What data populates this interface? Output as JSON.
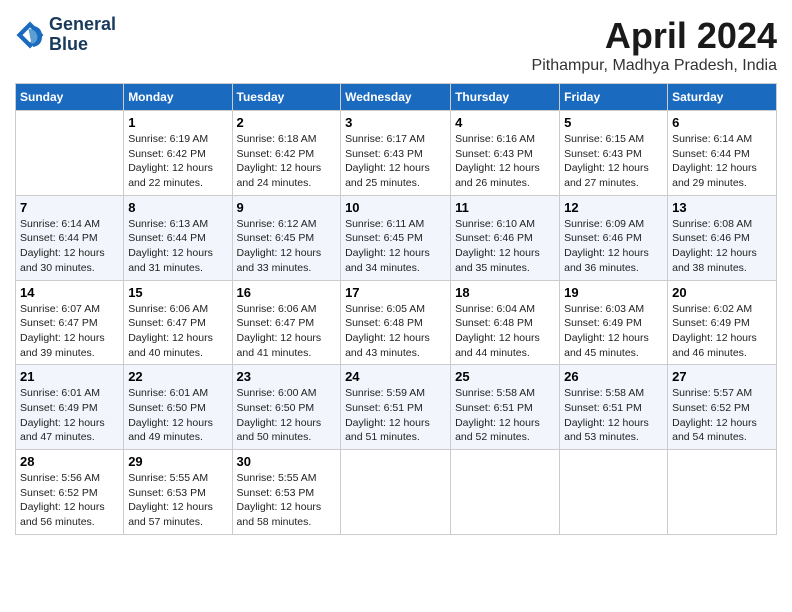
{
  "header": {
    "logo_line1": "General",
    "logo_line2": "Blue",
    "month": "April 2024",
    "location": "Pithampur, Madhya Pradesh, India"
  },
  "weekdays": [
    "Sunday",
    "Monday",
    "Tuesday",
    "Wednesday",
    "Thursday",
    "Friday",
    "Saturday"
  ],
  "weeks": [
    [
      {
        "day": "",
        "text": ""
      },
      {
        "day": "1",
        "text": "Sunrise: 6:19 AM\nSunset: 6:42 PM\nDaylight: 12 hours\nand 22 minutes."
      },
      {
        "day": "2",
        "text": "Sunrise: 6:18 AM\nSunset: 6:42 PM\nDaylight: 12 hours\nand 24 minutes."
      },
      {
        "day": "3",
        "text": "Sunrise: 6:17 AM\nSunset: 6:43 PM\nDaylight: 12 hours\nand 25 minutes."
      },
      {
        "day": "4",
        "text": "Sunrise: 6:16 AM\nSunset: 6:43 PM\nDaylight: 12 hours\nand 26 minutes."
      },
      {
        "day": "5",
        "text": "Sunrise: 6:15 AM\nSunset: 6:43 PM\nDaylight: 12 hours\nand 27 minutes."
      },
      {
        "day": "6",
        "text": "Sunrise: 6:14 AM\nSunset: 6:44 PM\nDaylight: 12 hours\nand 29 minutes."
      }
    ],
    [
      {
        "day": "7",
        "text": "Sunrise: 6:14 AM\nSunset: 6:44 PM\nDaylight: 12 hours\nand 30 minutes."
      },
      {
        "day": "8",
        "text": "Sunrise: 6:13 AM\nSunset: 6:44 PM\nDaylight: 12 hours\nand 31 minutes."
      },
      {
        "day": "9",
        "text": "Sunrise: 6:12 AM\nSunset: 6:45 PM\nDaylight: 12 hours\nand 33 minutes."
      },
      {
        "day": "10",
        "text": "Sunrise: 6:11 AM\nSunset: 6:45 PM\nDaylight: 12 hours\nand 34 minutes."
      },
      {
        "day": "11",
        "text": "Sunrise: 6:10 AM\nSunset: 6:46 PM\nDaylight: 12 hours\nand 35 minutes."
      },
      {
        "day": "12",
        "text": "Sunrise: 6:09 AM\nSunset: 6:46 PM\nDaylight: 12 hours\nand 36 minutes."
      },
      {
        "day": "13",
        "text": "Sunrise: 6:08 AM\nSunset: 6:46 PM\nDaylight: 12 hours\nand 38 minutes."
      }
    ],
    [
      {
        "day": "14",
        "text": "Sunrise: 6:07 AM\nSunset: 6:47 PM\nDaylight: 12 hours\nand 39 minutes."
      },
      {
        "day": "15",
        "text": "Sunrise: 6:06 AM\nSunset: 6:47 PM\nDaylight: 12 hours\nand 40 minutes."
      },
      {
        "day": "16",
        "text": "Sunrise: 6:06 AM\nSunset: 6:47 PM\nDaylight: 12 hours\nand 41 minutes."
      },
      {
        "day": "17",
        "text": "Sunrise: 6:05 AM\nSunset: 6:48 PM\nDaylight: 12 hours\nand 43 minutes."
      },
      {
        "day": "18",
        "text": "Sunrise: 6:04 AM\nSunset: 6:48 PM\nDaylight: 12 hours\nand 44 minutes."
      },
      {
        "day": "19",
        "text": "Sunrise: 6:03 AM\nSunset: 6:49 PM\nDaylight: 12 hours\nand 45 minutes."
      },
      {
        "day": "20",
        "text": "Sunrise: 6:02 AM\nSunset: 6:49 PM\nDaylight: 12 hours\nand 46 minutes."
      }
    ],
    [
      {
        "day": "21",
        "text": "Sunrise: 6:01 AM\nSunset: 6:49 PM\nDaylight: 12 hours\nand 47 minutes."
      },
      {
        "day": "22",
        "text": "Sunrise: 6:01 AM\nSunset: 6:50 PM\nDaylight: 12 hours\nand 49 minutes."
      },
      {
        "day": "23",
        "text": "Sunrise: 6:00 AM\nSunset: 6:50 PM\nDaylight: 12 hours\nand 50 minutes."
      },
      {
        "day": "24",
        "text": "Sunrise: 5:59 AM\nSunset: 6:51 PM\nDaylight: 12 hours\nand 51 minutes."
      },
      {
        "day": "25",
        "text": "Sunrise: 5:58 AM\nSunset: 6:51 PM\nDaylight: 12 hours\nand 52 minutes."
      },
      {
        "day": "26",
        "text": "Sunrise: 5:58 AM\nSunset: 6:51 PM\nDaylight: 12 hours\nand 53 minutes."
      },
      {
        "day": "27",
        "text": "Sunrise: 5:57 AM\nSunset: 6:52 PM\nDaylight: 12 hours\nand 54 minutes."
      }
    ],
    [
      {
        "day": "28",
        "text": "Sunrise: 5:56 AM\nSunset: 6:52 PM\nDaylight: 12 hours\nand 56 minutes."
      },
      {
        "day": "29",
        "text": "Sunrise: 5:55 AM\nSunset: 6:53 PM\nDaylight: 12 hours\nand 57 minutes."
      },
      {
        "day": "30",
        "text": "Sunrise: 5:55 AM\nSunset: 6:53 PM\nDaylight: 12 hours\nand 58 minutes."
      },
      {
        "day": "",
        "text": ""
      },
      {
        "day": "",
        "text": ""
      },
      {
        "day": "",
        "text": ""
      },
      {
        "day": "",
        "text": ""
      }
    ]
  ]
}
